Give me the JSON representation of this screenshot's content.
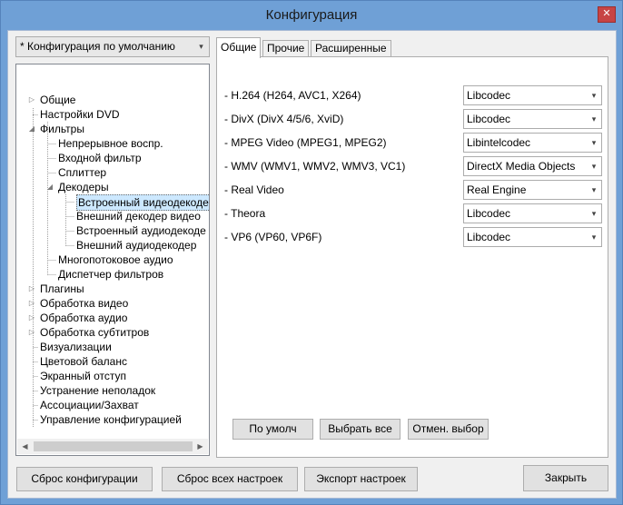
{
  "window": {
    "title": "Конфигурация",
    "close_glyph": "✕"
  },
  "preset": {
    "value": "* Конфигурация по умолчанию"
  },
  "tree": [
    {
      "label": "Общие",
      "expander": "▷"
    },
    {
      "label": "Настройки DVD",
      "expander": ""
    },
    {
      "label": "Фильтры",
      "expander": "◢"
    },
    {
      "label": "Непрерывное воспр.",
      "expander": ""
    },
    {
      "label": "Входной фильтр",
      "expander": ""
    },
    {
      "label": "Сплиттер",
      "expander": ""
    },
    {
      "label": "Декодеры",
      "expander": "◢"
    },
    {
      "label": "Встроенный видеодекоде",
      "expander": ""
    },
    {
      "label": "Внешний декодер видео",
      "expander": ""
    },
    {
      "label": "Встроенный аудиодекоде",
      "expander": ""
    },
    {
      "label": "Внешний аудиодекодер",
      "expander": ""
    },
    {
      "label": "Многопотоковое аудио",
      "expander": ""
    },
    {
      "label": "Диспетчер фильтров",
      "expander": ""
    },
    {
      "label": "Плагины",
      "expander": "▷"
    },
    {
      "label": "Обработка видео",
      "expander": "▷"
    },
    {
      "label": "Обработка аудио",
      "expander": "▷"
    },
    {
      "label": "Обработка субтитров",
      "expander": "▷"
    },
    {
      "label": "Визуализации",
      "expander": ""
    },
    {
      "label": "Цветовой баланс",
      "expander": ""
    },
    {
      "label": "Экранный отступ",
      "expander": ""
    },
    {
      "label": "Устранение неполадок",
      "expander": ""
    },
    {
      "label": "Ассоциации/Захват",
      "expander": ""
    },
    {
      "label": "Управление конфигурацией",
      "expander": ""
    }
  ],
  "scroll": {
    "left_glyph": "◀",
    "right_glyph": "▶"
  },
  "tabs": [
    {
      "label": "Общие"
    },
    {
      "label": "Прочие"
    },
    {
      "label": "Расширенные"
    }
  ],
  "codecs": [
    {
      "label": "- H.264 (H264, AVC1, X264)",
      "value": "Libcodec"
    },
    {
      "label": "- DivX (DivX 4/5/6, XviD)",
      "value": "Libcodec"
    },
    {
      "label": "- MPEG Video (MPEG1, MPEG2)",
      "value": "Libintelcodec"
    },
    {
      "label": "- WMV (WMV1, WMV2, WMV3, VC1)",
      "value": "DirectX Media Objects"
    },
    {
      "label": "- Real Video",
      "value": "Real Engine"
    },
    {
      "label": "- Theora",
      "value": "Libcodec"
    },
    {
      "label": "- VP6 (VP60, VP6F)",
      "value": "Libcodec"
    }
  ],
  "dropdown_glyph": "▾",
  "panel_buttons": {
    "default_label": "По умолч",
    "select_all_label": "Выбрать все",
    "deselect_label": "Отмен. выбор"
  },
  "footer_buttons": {
    "reset_config_label": "Сброс конфигурации",
    "reset_all_label": "Сброс всех настроек",
    "export_label": "Экспорт настроек",
    "close_label": "Закрыть"
  }
}
